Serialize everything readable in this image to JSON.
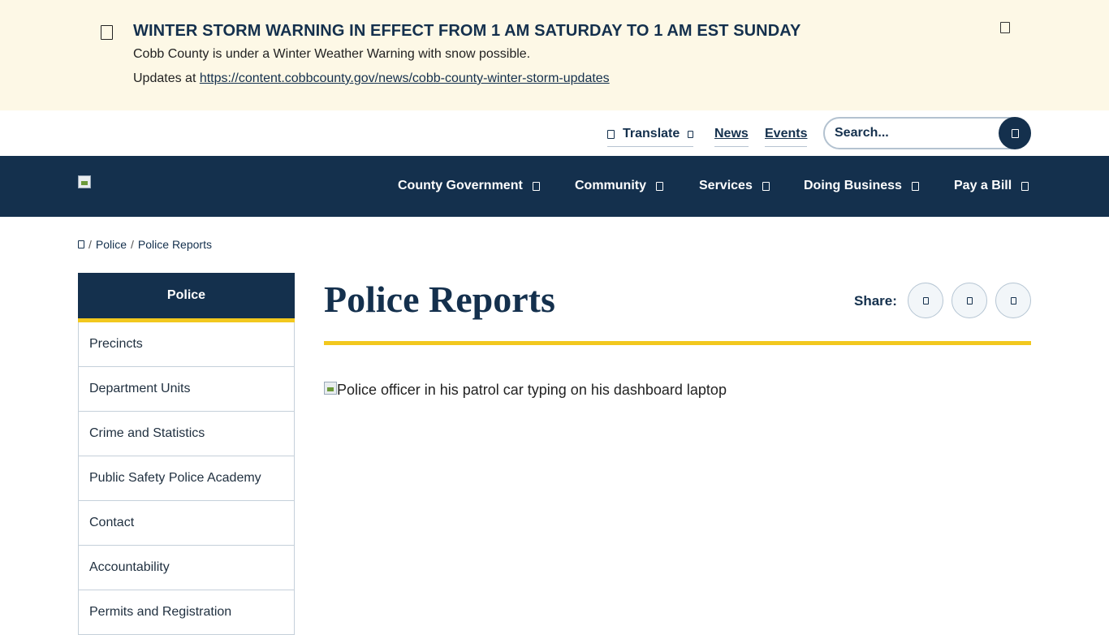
{
  "alert": {
    "title": "WINTER STORM WARNING IN EFFECT FROM 1 AM SATURDAY TO 1 AM EST SUNDAY",
    "line1": "Cobb County is under a Winter Weather Warning with snow possible.",
    "line2_prefix": "Updates at ",
    "link_text": "https://content.cobbcounty.gov/news/cobb-county-winter-storm-updates",
    "icon": "alert-icon",
    "close_icon": "close-icon"
  },
  "utility": {
    "translate_label": "Translate",
    "news_label": "News",
    "events_label": "Events",
    "search_placeholder": "Search..."
  },
  "nav": {
    "items": [
      {
        "label": "County Government"
      },
      {
        "label": "Community"
      },
      {
        "label": "Services"
      },
      {
        "label": "Doing Business"
      },
      {
        "label": "Pay a Bill"
      }
    ]
  },
  "breadcrumb": {
    "home_icon": "home-icon",
    "separator": "/",
    "items": [
      "Police",
      "Police Reports"
    ]
  },
  "sidebar": {
    "heading": "Police",
    "items": [
      {
        "label": "Precincts"
      },
      {
        "label": "Department Units"
      },
      {
        "label": "Crime and Statistics"
      },
      {
        "label": "Public Safety Police Academy"
      },
      {
        "label": "Contact"
      },
      {
        "label": "Accountability"
      },
      {
        "label": "Permits and Registration"
      }
    ]
  },
  "main": {
    "title": "Police Reports",
    "share_label": "Share:",
    "share_icons": [
      "facebook-icon",
      "twitter-icon",
      "email-icon"
    ],
    "image_alt": "Police officer in his patrol car typing on his dashboard laptop"
  },
  "colors": {
    "navy": "#14304d",
    "gold": "#f2c81e",
    "alert_bg": "#fdf8e6"
  }
}
